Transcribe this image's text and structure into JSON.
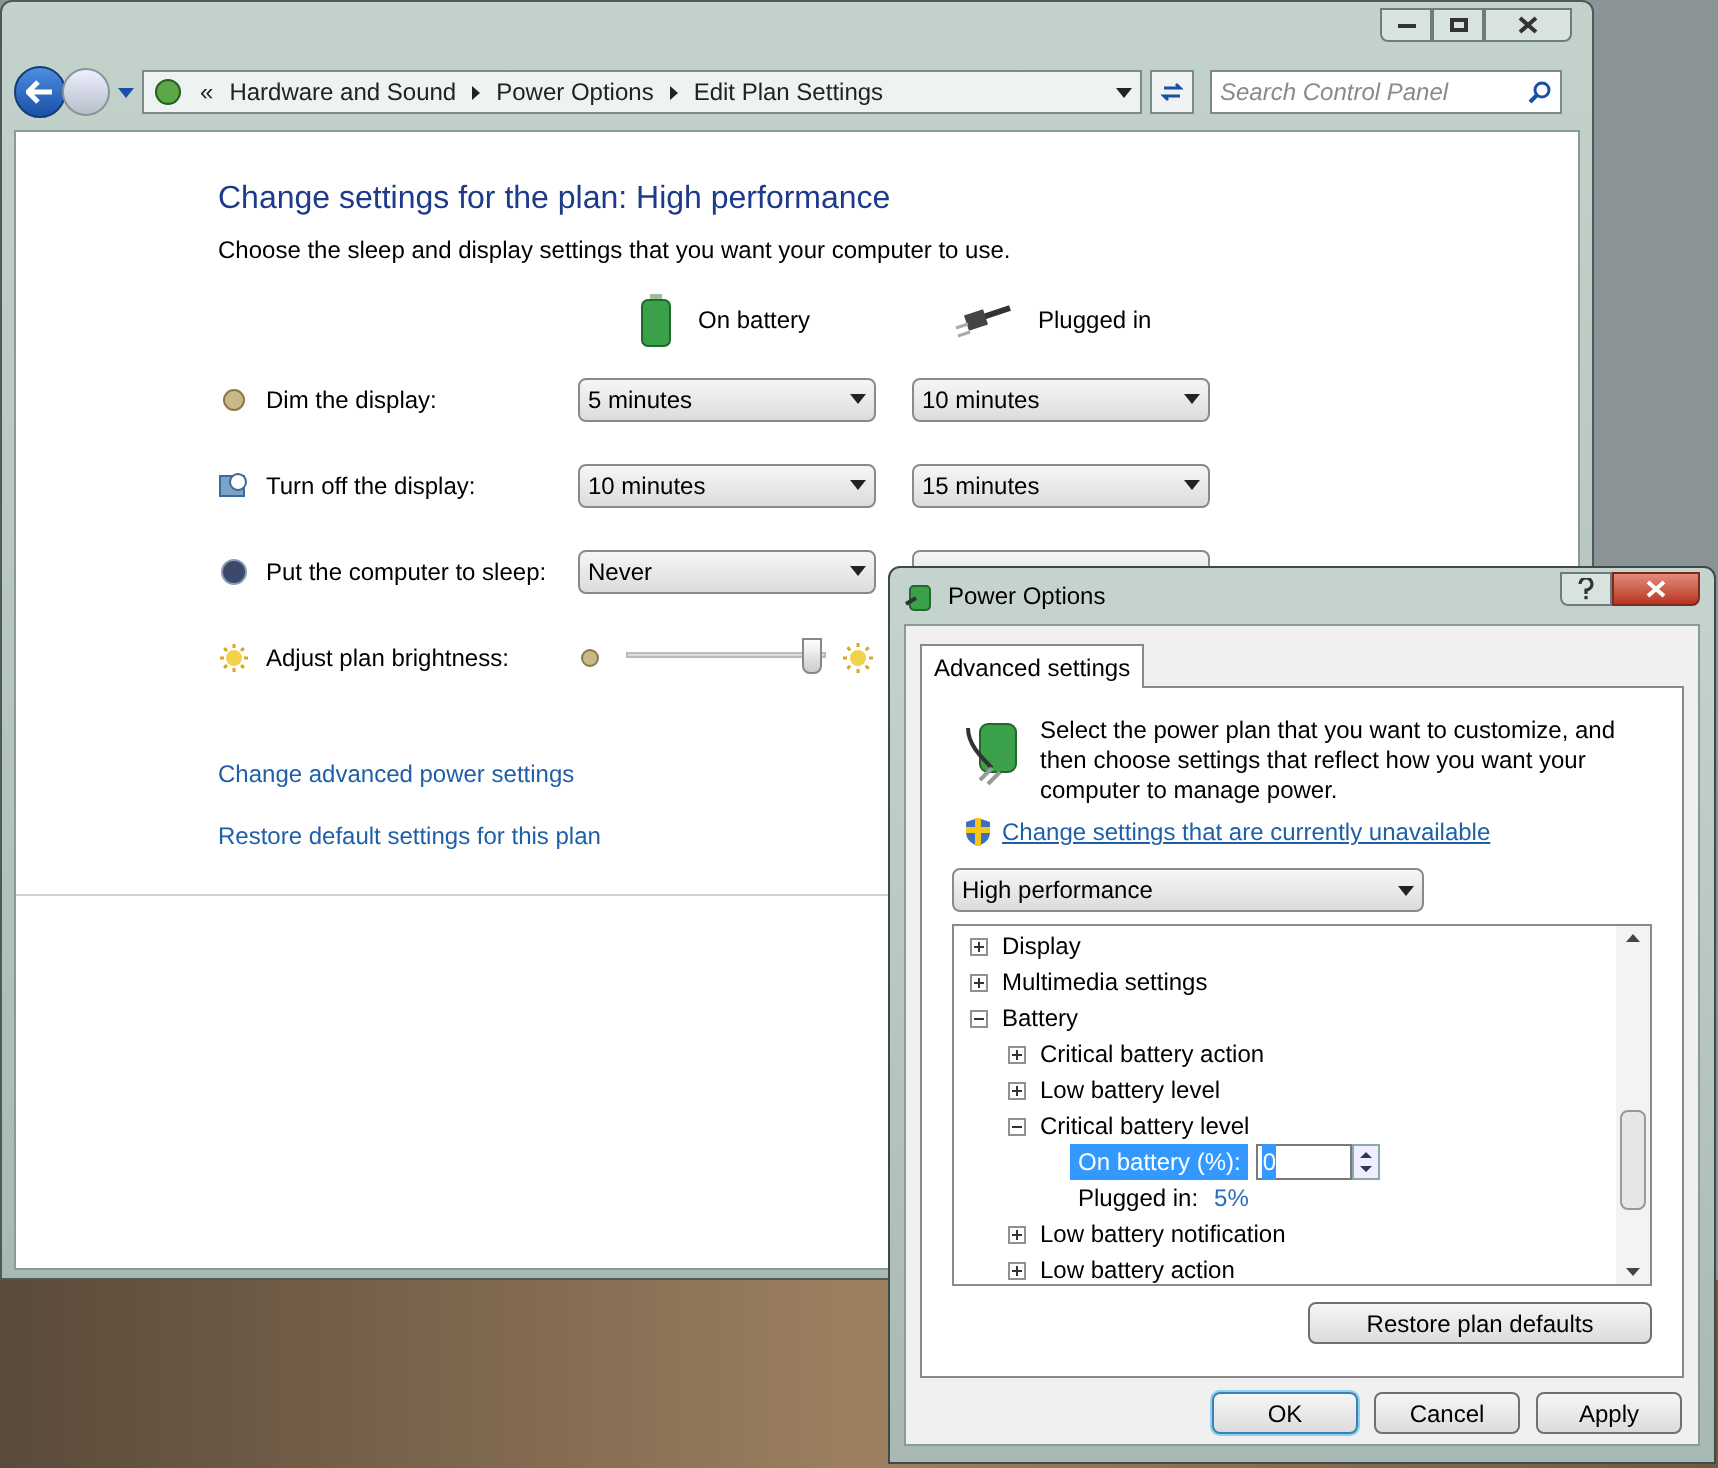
{
  "window": {
    "breadcrumb": [
      "«",
      "Hardware and Sound",
      "Power Options",
      "Edit Plan Settings"
    ],
    "search": {
      "placeholder": "Search Control Panel"
    }
  },
  "page": {
    "title": "Change settings for the plan: High performance",
    "subtitle": "Choose the sleep and display settings that you want your computer to use.",
    "columns": [
      "On battery",
      "Plugged in"
    ],
    "settings": [
      {
        "kind": "dropdown",
        "label": "Dim the display:",
        "on_battery": "5 minutes",
        "plugged_in": "10 minutes"
      },
      {
        "kind": "dropdown",
        "label": "Turn off the display:",
        "on_battery": "10 minutes",
        "plugged_in": "15 minutes"
      },
      {
        "kind": "dropdown",
        "label": "Put the computer to sleep:",
        "on_battery": "Never"
      },
      {
        "kind": "slider",
        "label": "Adjust plan brightness:",
        "level": 0.93
      }
    ],
    "links": [
      "Change advanced power settings",
      "Restore default settings for this plan"
    ]
  },
  "dialog": {
    "title": "Power Options",
    "tabs": [
      {
        "label": "Advanced settings",
        "selected": true
      }
    ],
    "description": "Select the power plan that you want to customize, and then choose settings that reflect how you want your computer to manage power.",
    "shield_link": "Change settings that are currently unavailable",
    "plan": "High performance",
    "tree": [
      {
        "label": "Display",
        "expanded": false
      },
      {
        "label": "Multimedia settings",
        "expanded": false
      },
      {
        "label": "Battery",
        "expanded": true,
        "children": [
          {
            "label": "Critical battery action",
            "expanded": false
          },
          {
            "label": "Low battery level",
            "expanded": false
          },
          {
            "label": "Critical battery level",
            "expanded": true,
            "children": [
              {
                "kind": "spin",
                "label": "On battery (%):",
                "value": "0",
                "selected": true
              },
              {
                "kind": "value",
                "label": "Plugged in:",
                "value": "5%",
                "selected": false
              }
            ]
          },
          {
            "label": "Low battery notification",
            "expanded": false
          },
          {
            "label": "Low battery action",
            "expanded": false
          }
        ]
      }
    ],
    "restore_button": "Restore plan defaults",
    "buttons": [
      "OK",
      "Cancel",
      "Apply"
    ]
  }
}
